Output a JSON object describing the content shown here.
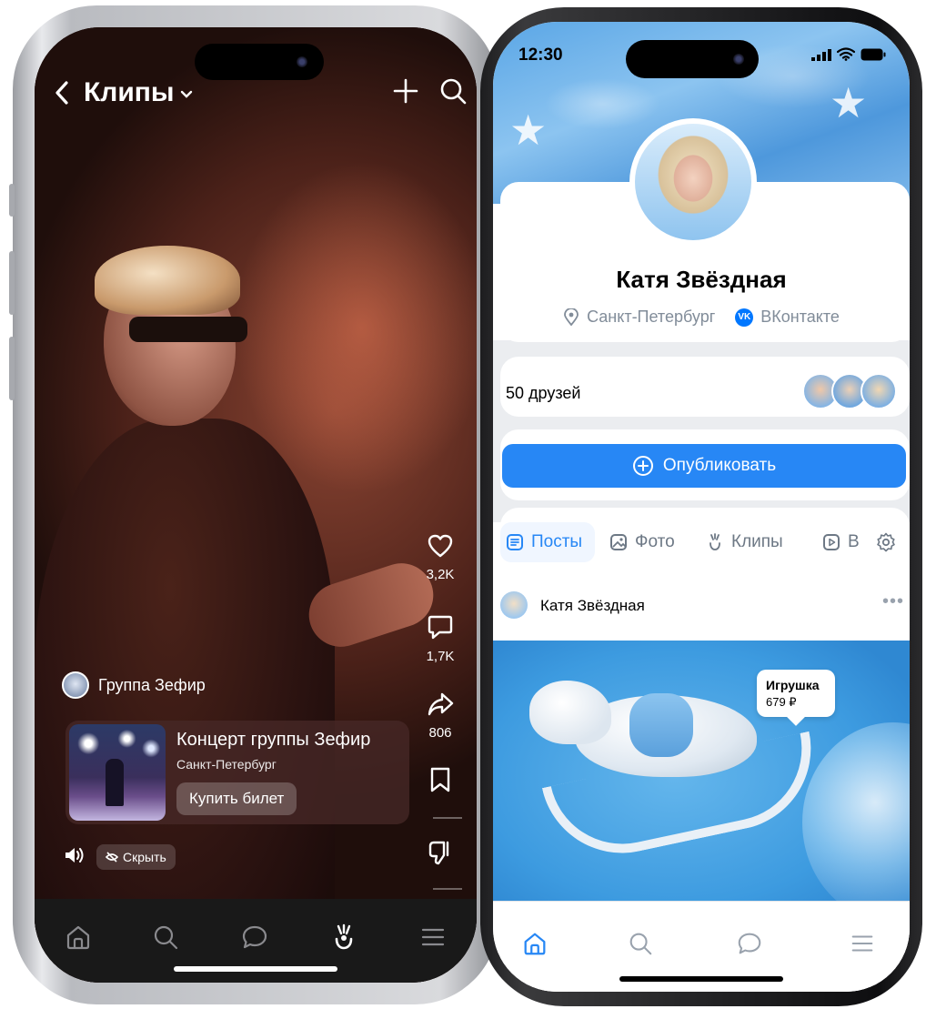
{
  "left_phone": {
    "header": {
      "title": "Клипы"
    },
    "rail": {
      "likes": "3,2K",
      "comments": "1,7K",
      "shares": "806"
    },
    "author": {
      "name": "Группа Зефир"
    },
    "event": {
      "title": "Концерт группы Зефир",
      "city": "Санкт-Петербург",
      "buy_label": "Купить билет"
    },
    "hide_label": "Скрыть",
    "tabbar": [
      "home-icon",
      "search-icon",
      "messages-icon",
      "clips-icon",
      "menu-icon"
    ]
  },
  "right_phone": {
    "status": {
      "time": "12:30"
    },
    "profile": {
      "name": "Катя Звёздная",
      "city": "Санкт-Петербург",
      "network": "ВКонтакте",
      "network_badge": "VK"
    },
    "friends": {
      "label": "50 друзей"
    },
    "publish_label": "Опубликовать",
    "tabs": [
      {
        "label": "Посты",
        "active": true
      },
      {
        "label": "Фото",
        "active": false
      },
      {
        "label": "Клипы",
        "active": false
      },
      {
        "label": "В",
        "active": false
      }
    ],
    "post": {
      "author": "Катя Звёздная",
      "more": "•••",
      "price_tag": {
        "name": "Игрушка",
        "price": "679 ₽"
      }
    },
    "tabbar": [
      "home-icon",
      "search-icon",
      "messages-icon",
      "menu-icon"
    ]
  },
  "colors": {
    "vk_blue": "#2787f5",
    "clip_bg": "#4b2119",
    "dark_tabbar": "#191919"
  }
}
